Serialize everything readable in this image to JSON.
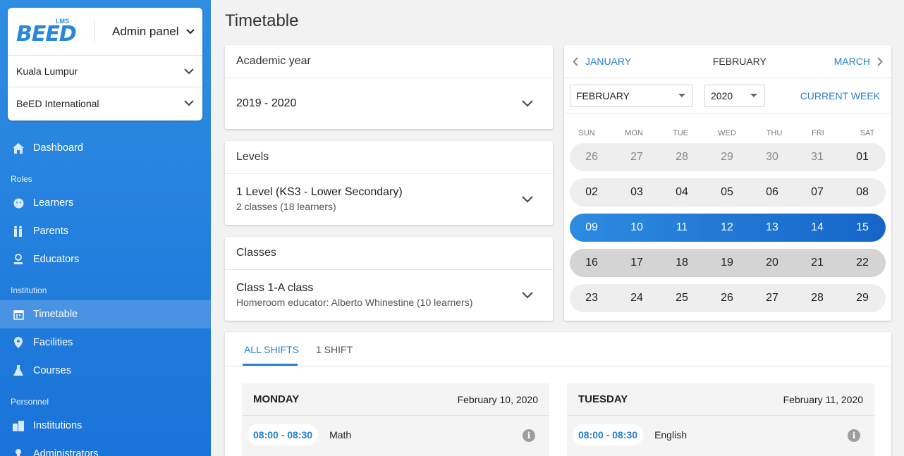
{
  "brand": {
    "logo_text": "BEED",
    "logo_sub": "LMS",
    "panel_label": "Admin panel",
    "locations": [
      "Kuala Lumpur",
      "BeED International"
    ]
  },
  "sidebar": {
    "dashboard": "Dashboard",
    "sections": {
      "roles": "Roles",
      "institution": "Institution",
      "personnel": "Personnel"
    },
    "roles": [
      "Learners",
      "Parents",
      "Educators"
    ],
    "institution": [
      "Timetable",
      "Facilities",
      "Courses"
    ],
    "personnel": [
      "Institutions",
      "Administrators"
    ],
    "active": "Timetable"
  },
  "page": {
    "title": "Timetable"
  },
  "academic_year": {
    "title": "Academic year",
    "value": "2019 - 2020"
  },
  "levels": {
    "title": "Levels",
    "value": "1 Level (KS3 - Lower Secondary)",
    "sub": "2 classes (18 learners)"
  },
  "classes": {
    "title": "Classes",
    "value": "Class 1-A class",
    "sub": "Homeroom educator: Alberto Whinestine (10 learners)"
  },
  "calendar": {
    "prev": "JANUARY",
    "current": "FEBRUARY",
    "next": "MARCH",
    "month_select": "FEBRUARY",
    "year_select": "2020",
    "current_week": "CURRENT WEEK",
    "weekdays": [
      "SUN",
      "MON",
      "TUE",
      "WED",
      "THU",
      "FRI",
      "SAT"
    ],
    "weeks": [
      [
        "26",
        "27",
        "28",
        "29",
        "30",
        "31",
        "01"
      ],
      [
        "02",
        "03",
        "04",
        "05",
        "06",
        "07",
        "08"
      ],
      [
        "09",
        "10",
        "11",
        "12",
        "13",
        "14",
        "15"
      ],
      [
        "16",
        "17",
        "18",
        "19",
        "20",
        "21",
        "22"
      ],
      [
        "23",
        "24",
        "25",
        "26",
        "27",
        "28",
        "29"
      ]
    ]
  },
  "shifts": {
    "tabs": [
      "ALL SHIFTS",
      "1 SHIFT"
    ],
    "days": [
      {
        "name": "MONDAY",
        "date": "February 10, 2020",
        "time": "08:00 - 08:30",
        "subject": "Math"
      },
      {
        "name": "TUESDAY",
        "date": "February 11, 2020",
        "time": "08:00 - 08:30",
        "subject": "English"
      }
    ]
  },
  "colors": {
    "primary": "#2a7fd4",
    "sidebar": "#2f8ee2",
    "selected_week": "#1a73d9",
    "gray_week": "#d4d4d4"
  }
}
